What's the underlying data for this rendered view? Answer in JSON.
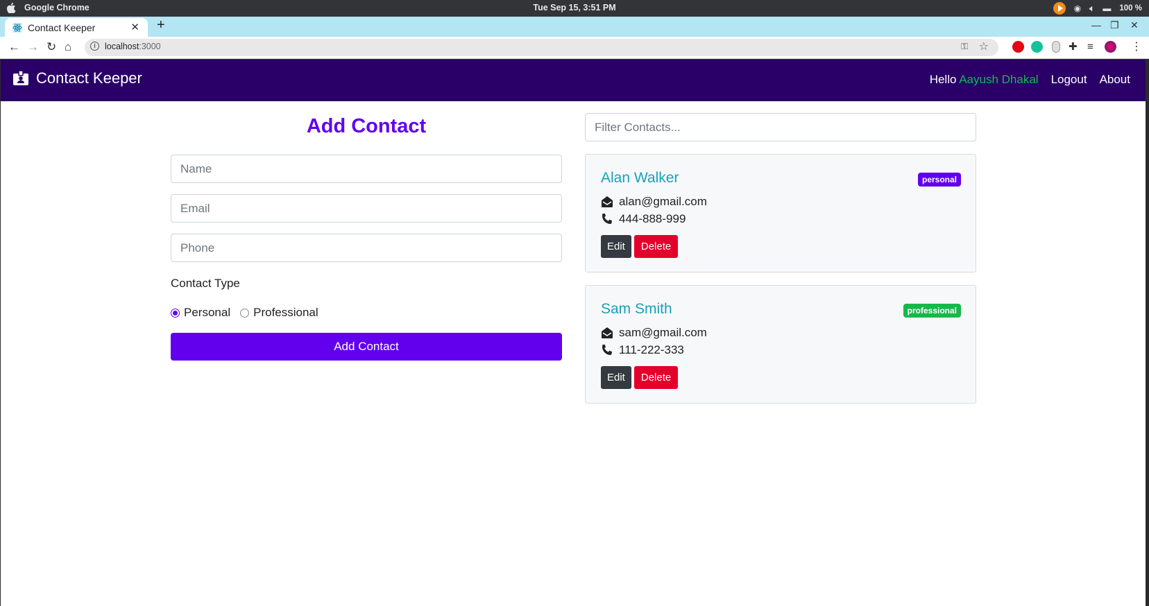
{
  "os": {
    "app_name": "Google Chrome",
    "clock": "Tue Sep 15,  3:51 PM",
    "battery": "100 %"
  },
  "browser": {
    "tab_title": "Contact Keeper",
    "url_host": "localhost",
    "url_port": ":3000"
  },
  "navbar": {
    "brand": "Contact Keeper",
    "greeting": "Hello ",
    "user_name": "Aayush Dhakal",
    "links": [
      "Logout",
      "About"
    ]
  },
  "form": {
    "title": "Add Contact",
    "name_placeholder": "Name",
    "email_placeholder": "Email",
    "phone_placeholder": "Phone",
    "type_label": "Contact Type",
    "options": [
      {
        "label": "Personal",
        "checked": true
      },
      {
        "label": "Professional",
        "checked": false
      }
    ],
    "submit_label": "Add Contact"
  },
  "contacts": {
    "filter_placeholder": "Filter Contacts...",
    "items": [
      {
        "name": "Alan Walker",
        "type": "personal",
        "email": "alan@gmail.com",
        "phone": "444-888-999",
        "badge_color": "#6200ee"
      },
      {
        "name": "Sam Smith",
        "type": "professional",
        "email": "sam@gmail.com",
        "phone": "111-222-333",
        "badge_color": "#17b84a"
      }
    ],
    "edit_label": "Edit",
    "delete_label": "Delete"
  },
  "colors": {
    "navbar_bg": "#2a0068",
    "primary": "#6200ee",
    "user_name": "#16b757",
    "contact_name": "#17a2b8",
    "danger": "#e4002b",
    "dark": "#343a40"
  }
}
